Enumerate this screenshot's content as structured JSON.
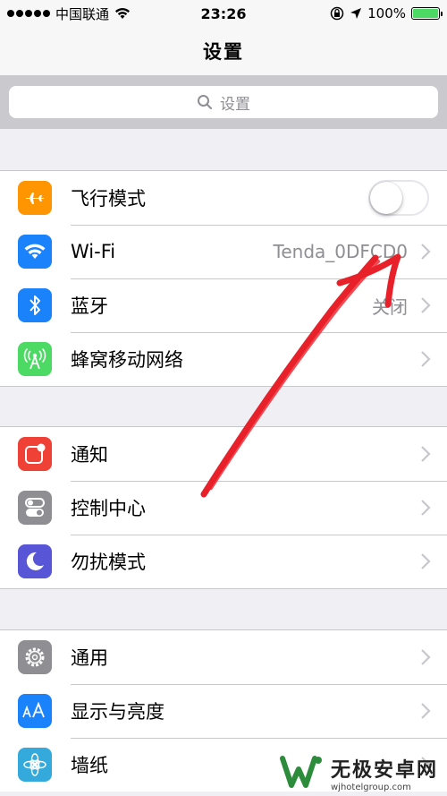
{
  "status_bar": {
    "carrier": "中国联通",
    "time": "23:26",
    "battery_percent": "100%",
    "battery_level": 1.0
  },
  "nav": {
    "title": "设置"
  },
  "search": {
    "placeholder": "设置"
  },
  "groups": [
    {
      "rows": [
        {
          "label": "飞行模式",
          "icon": "airplane-icon",
          "icon_color": "#ff9500",
          "toggle_on": false
        },
        {
          "label": "Wi-Fi",
          "icon": "wifi-icon",
          "icon_color": "#1a82fb",
          "value": "Tenda_0DFCD0"
        },
        {
          "label": "蓝牙",
          "icon": "bluetooth-icon",
          "icon_color": "#1a82fb",
          "value": "关闭"
        },
        {
          "label": "蜂窝移动网络",
          "icon": "cellular-icon",
          "icon_color": "#4cd964"
        }
      ]
    },
    {
      "rows": [
        {
          "label": "通知",
          "icon": "notification-icon",
          "icon_color": "#f04136"
        },
        {
          "label": "控制中心",
          "icon": "control-center-icon",
          "icon_color": "#8e8e93"
        },
        {
          "label": "勿扰模式",
          "icon": "moon-icon",
          "icon_color": "#5856d6"
        }
      ]
    },
    {
      "rows": [
        {
          "label": "通用",
          "icon": "gear-icon",
          "icon_color": "#8e8e93"
        },
        {
          "label": "显示与亮度",
          "icon": "display-icon",
          "icon_color": "#1a82fb"
        },
        {
          "label": "墙纸",
          "icon": "wallpaper-icon",
          "icon_color": "#34aadc"
        }
      ]
    }
  ],
  "watermark": {
    "title": "无极安卓网",
    "url": "wjhotelgroup.com"
  },
  "colors": {
    "background": "#efeff4",
    "annotation_stroke": "#e8202a",
    "chevron": "#c7c7cc"
  }
}
